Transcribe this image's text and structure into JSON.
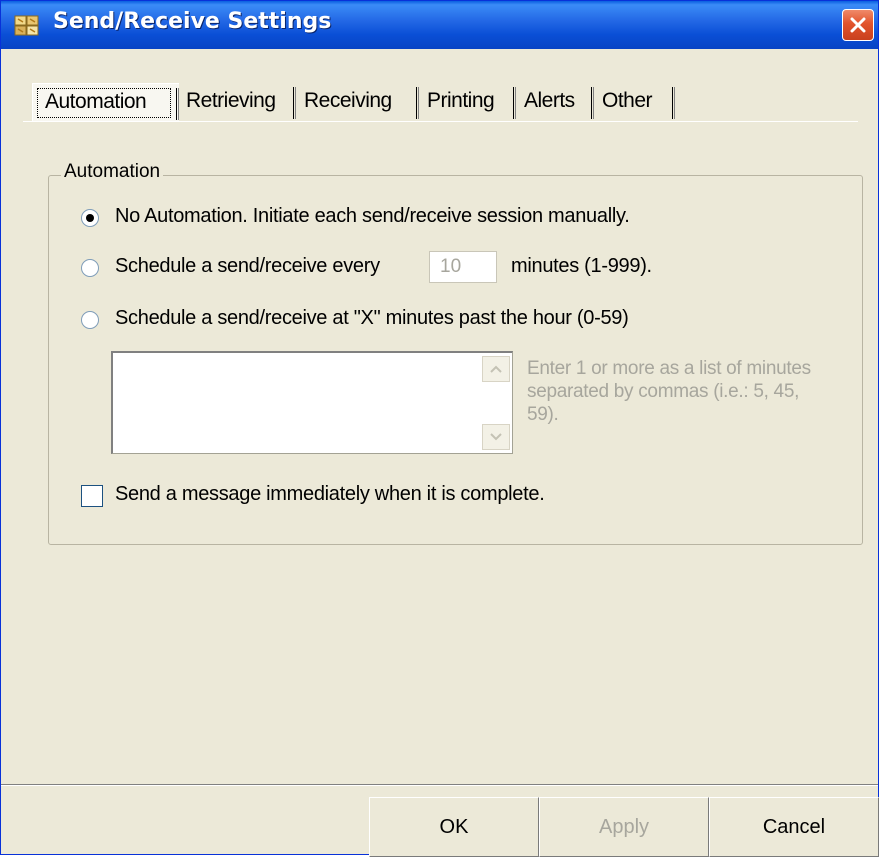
{
  "window": {
    "title": "Send/Receive Settings"
  },
  "tabs": [
    {
      "label": "Automation",
      "active": true
    },
    {
      "label": "Retrieving",
      "active": false
    },
    {
      "label": "Receiving",
      "active": false
    },
    {
      "label": "Printing",
      "active": false
    },
    {
      "label": "Alerts",
      "active": false
    },
    {
      "label": "Other",
      "active": false
    }
  ],
  "automation": {
    "group_label": "Automation",
    "option_none": "No Automation.  Initiate each send/receive session manually.",
    "option_every_prefix": "Schedule a send/receive every",
    "interval_value": "10",
    "option_every_suffix": "minutes (1-999).",
    "option_past_hour": "Schedule a send/receive at \"X\" minutes past the hour (0-59)",
    "minutes_list_value": "",
    "minutes_hint": "Enter 1 or more as a list of minutes separated by commas (i.e.: 5, 45, 59).",
    "send_immediately": "Send a message immediately when it is complete.",
    "selected_option": "none",
    "send_immediately_checked": false
  },
  "buttons": {
    "ok": "OK",
    "apply": "Apply",
    "cancel": "Cancel"
  },
  "colors": {
    "titlebar": "#0a4fd6",
    "dialog": "#ece9d8",
    "close": "#e2532c",
    "disabled_text": "#a7a69d"
  }
}
